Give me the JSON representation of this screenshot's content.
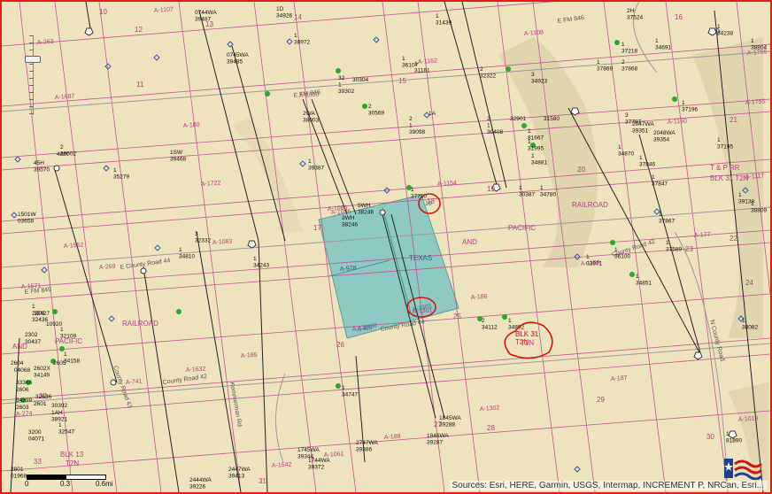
{
  "attribution": "Sources: Esri, HERE, Garmin, USGS, Intermap, INCREMENT P, NRCan, Esri...",
  "scale": {
    "t0": "0",
    "t1": "0.3",
    "t2": "0.6mi"
  },
  "colors": {
    "frame": "#e21b1b",
    "parcel": "#7fc6c4",
    "survey_line": "#c2558e",
    "well": "#2aa82a",
    "circle": "#d01414"
  },
  "icons": {
    "zoom": "zoom-slider",
    "logo": "rrc-logo-icon"
  },
  "abstracts": [
    "A-263",
    "A-1107",
    "A-1108",
    "A-1687",
    "A-180",
    "A-1722",
    "A-1086",
    "A-1083",
    "A-269",
    "A-1552",
    "A-1571",
    "A-978",
    "A-1301",
    "A-1468",
    "A-186",
    "A-1154",
    "A-1159",
    "A-177",
    "A-1117",
    "A-1160",
    "A-1755",
    "A-1755",
    "A-1632",
    "A-741",
    "A-185",
    "A-188",
    "A-1302",
    "A-187",
    "A-1013",
    "A-1542",
    "A-1061",
    "A-274",
    "A-1050",
    "A-1096",
    "A-1162"
  ],
  "sections": [
    "12",
    "13",
    "14",
    "15",
    "16",
    "17",
    "18",
    "19",
    "20",
    "21",
    "22",
    "23",
    "24",
    "25",
    "26",
    "27",
    "28",
    "29",
    "30",
    "31",
    "32",
    "33",
    "10",
    "11"
  ],
  "roads": [
    "E County Road 44",
    "County Road 42",
    "County Road 42",
    "County Road 43",
    "E FM 846",
    "E FM 846",
    "Kemmerman Rd",
    "N County Road",
    "County Road 44",
    "E FM 849"
  ],
  "region_words": [
    "TEXAS",
    "AND",
    "PACIFIC",
    "RAILROAD",
    "RAILROAD",
    "AND",
    "PACIFIC",
    "T & P RR",
    "BLK 31 T2N",
    "BLK 31",
    "T2N",
    "BLK 13",
    "T2N"
  ],
  "well_labels": [
    "1D 34926",
    "0744WA 39487",
    "1 31439",
    "2H 37524",
    "1 34691",
    "1 34238",
    "1 38972",
    "0745WA 39485",
    "1 36107",
    "1 31161",
    "2 32322",
    "3 34923",
    "1 37869",
    "2 37868",
    "1 37218",
    "1 38804",
    "32 1 39302",
    "30304",
    "2WA 38003",
    "2 30569",
    "2 1 39098",
    "1A",
    "2 1 30408",
    "32901",
    "31580",
    "1 81667",
    "1 31995",
    "1 34881",
    "3 37797",
    "2047WA 39351",
    "2048WA 39354",
    "1 37196",
    "1 37195",
    "1 34870",
    "1 37846",
    "1 37847",
    "2 39502",
    "4AH",
    "45H 39570",
    "1 35279",
    "1SW 39468",
    "1 39387",
    "3 32332",
    "1 34810",
    "1 34243",
    "5WH 38246",
    "3WH 38246",
    "1 37790",
    "1 30387",
    "1 34780",
    "1 37867",
    "1 37589",
    "1 36100",
    "1 03971",
    "1 34851",
    "1 38082",
    "1 39138",
    "1 38809",
    "1501W 03658",
    "1 2303 32436",
    "32427",
    "10920",
    "1 32109",
    "2302",
    "30437",
    "1 34158",
    "2604",
    "04068",
    "2602X 34149",
    "2605",
    "33366",
    "2606",
    "34399",
    "2603",
    "32636",
    "2601",
    "30392",
    "1AH 38921",
    "1 32547",
    "3200 04071",
    "2801 01968",
    "2 34112",
    "1 34892",
    "1 34747",
    "1845WA 39288",
    "1846WA 39287",
    "1745WA 39344",
    "1744WA 39372",
    "2747WA 39386",
    "2447WA 39413",
    "2444WA 39226",
    "1 81890"
  ],
  "annotation": "BLK 31\nT2N",
  "parcel_labels": [
    "A-978",
    "A-1301",
    "A-1468",
    "TEXAS",
    "16"
  ]
}
